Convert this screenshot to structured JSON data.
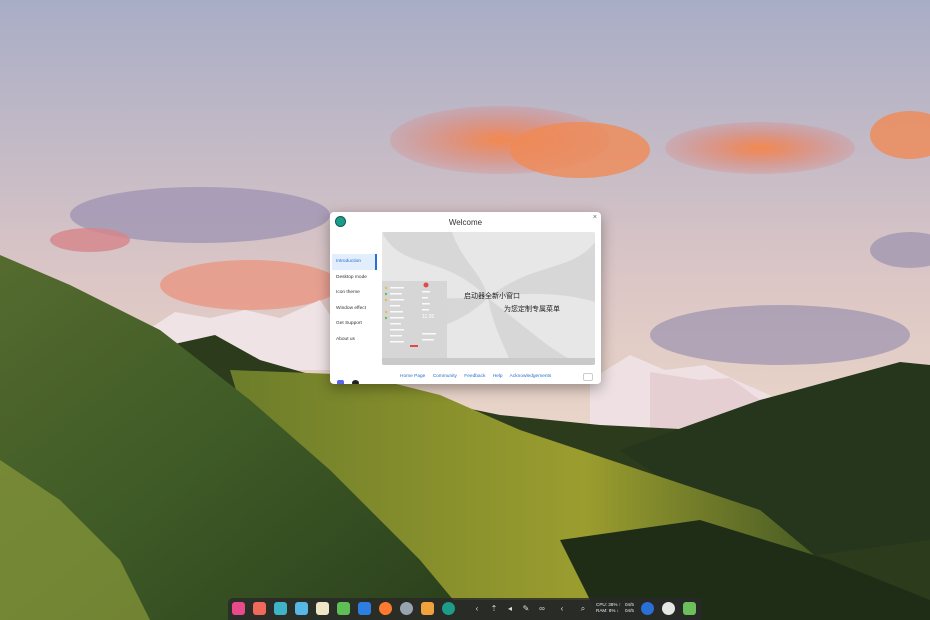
{
  "dialog": {
    "title": "Welcome",
    "close_glyph": "×",
    "nav_items": [
      {
        "label": "Introduction",
        "active": true
      },
      {
        "label": "Desktop mode",
        "active": false
      },
      {
        "label": "Icon theme",
        "active": false
      },
      {
        "label": "Window effect",
        "active": false
      },
      {
        "label": "Get Support",
        "active": false
      },
      {
        "label": "About us",
        "active": false
      }
    ],
    "preview": {
      "line1": "启动器全新小窗口",
      "line2": "为您定制专属菜单",
      "clock": "11:26"
    },
    "footer_links": [
      "Home Page",
      "Community",
      "Feedback",
      "Help",
      "Acknowledgements"
    ],
    "social_icons": [
      "discord-icon",
      "qq-icon"
    ]
  },
  "dock": {
    "apps": [
      {
        "name": "launcher-icon",
        "color": "#e84a8a"
      },
      {
        "name": "screen-recorder-icon",
        "color": "#ef6a5a"
      },
      {
        "name": "file-manager-icon",
        "color": "#3fb4c8"
      },
      {
        "name": "app-store-icon",
        "color": "#57b8e6"
      },
      {
        "name": "text-editor-icon",
        "color": "#efe6c7"
      },
      {
        "name": "terminal-icon",
        "color": "#5fbf56"
      },
      {
        "name": "media-player-icon",
        "color": "#2e7de1"
      },
      {
        "name": "firefox-icon",
        "color": "#ff7a2f"
      },
      {
        "name": "settings-icon",
        "color": "#9aa4b1"
      },
      {
        "name": "image-viewer-icon",
        "color": "#f0a23c"
      },
      {
        "name": "welcome-app-icon",
        "color": "#1e9c8a"
      }
    ],
    "tray": {
      "arrow": "‹",
      "items": [
        "⇡",
        "◂",
        "✎",
        "∞",
        "‹"
      ],
      "search": "⌕"
    },
    "system": {
      "cpu": "CPU: 38%",
      "ram": "RAM: 8%",
      "up": "↑",
      "down": "↓"
    },
    "clock": {
      "time": "04/5",
      "date": "04/5"
    },
    "right_apps": [
      {
        "name": "power-icon",
        "color": "#2a6fd3"
      },
      {
        "name": "deepin-logo-icon",
        "color": "#e6e6e6"
      },
      {
        "name": "trash-icon",
        "color": "#6cbf5b"
      }
    ]
  }
}
